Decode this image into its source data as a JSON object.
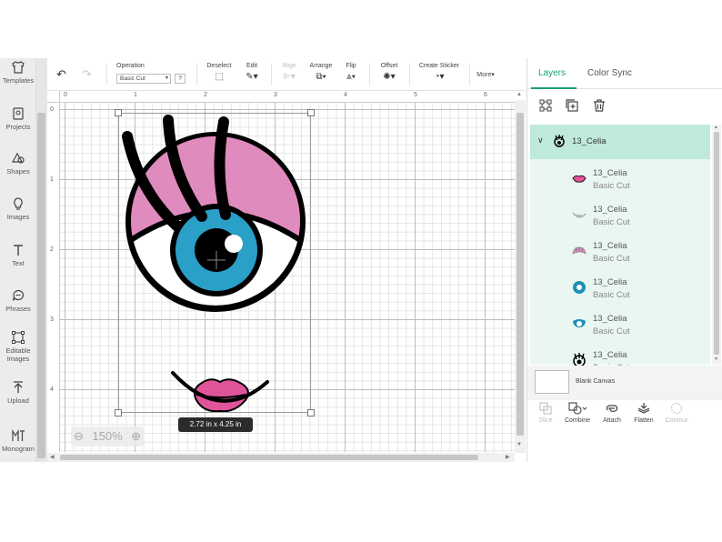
{
  "sidebar": {
    "items": [
      {
        "label": "Templates",
        "icon": "shirt-icon"
      },
      {
        "label": "Projects",
        "icon": "projects-icon"
      },
      {
        "label": "Shapes",
        "icon": "shapes-icon"
      },
      {
        "label": "Images",
        "icon": "lightbulb-icon"
      },
      {
        "label": "Text",
        "icon": "text-icon"
      },
      {
        "label": "Phrases",
        "icon": "speech-bubble-icon"
      },
      {
        "label": "Editable Images",
        "icon": "editable-images-icon"
      },
      {
        "label": "Upload",
        "icon": "upload-icon"
      },
      {
        "label": "Monogram",
        "icon": "monogram-icon"
      }
    ]
  },
  "toolbar": {
    "operation_label": "Operation",
    "operation_value": "Basic Cut",
    "operation_help": "?",
    "deselect": "Deselect",
    "edit": "Edit",
    "align": "Align",
    "arrange": "Arrange",
    "flip": "Flip",
    "offset": "Offset",
    "create_sticker": "Create Sticker",
    "more": "More"
  },
  "rulers": {
    "top": [
      "0",
      "1",
      "2",
      "3",
      "4",
      "5",
      "6"
    ],
    "left": [
      "0",
      "1",
      "2",
      "3",
      "4"
    ]
  },
  "canvas": {
    "zoom": "150%",
    "dimensions": "2.72  in x 4.25  in"
  },
  "panel": {
    "tabs": [
      "Layers",
      "Color Sync"
    ],
    "group_name": "13_Celia",
    "layers": [
      {
        "name": "13_Celia",
        "operation": "Basic Cut",
        "icon": "lips-thumb-icon"
      },
      {
        "name": "13_Celia",
        "operation": "Basic Cut",
        "icon": "smile-thumb-icon"
      },
      {
        "name": "13_Celia",
        "operation": "Basic Cut",
        "icon": "eyelid-thumb-icon"
      },
      {
        "name": "13_Celia",
        "operation": "Basic Cut",
        "icon": "iris-thumb-icon"
      },
      {
        "name": "13_Celia",
        "operation": "Basic Cut",
        "icon": "iris-shape-thumb-icon"
      },
      {
        "name": "13_Celia",
        "operation": "Basic Cut",
        "icon": "eye-outline-thumb-icon"
      }
    ],
    "blank_canvas": "Blank Canvas",
    "bottom_tools": [
      "Slice",
      "Combine",
      "Attach",
      "Flatten",
      "Contour"
    ]
  },
  "colors": {
    "accent": "#1a9e7a",
    "eyelid_pink": "#e08bbd",
    "iris_blue": "#2a9fc8",
    "lips_pink": "#e0559a"
  }
}
